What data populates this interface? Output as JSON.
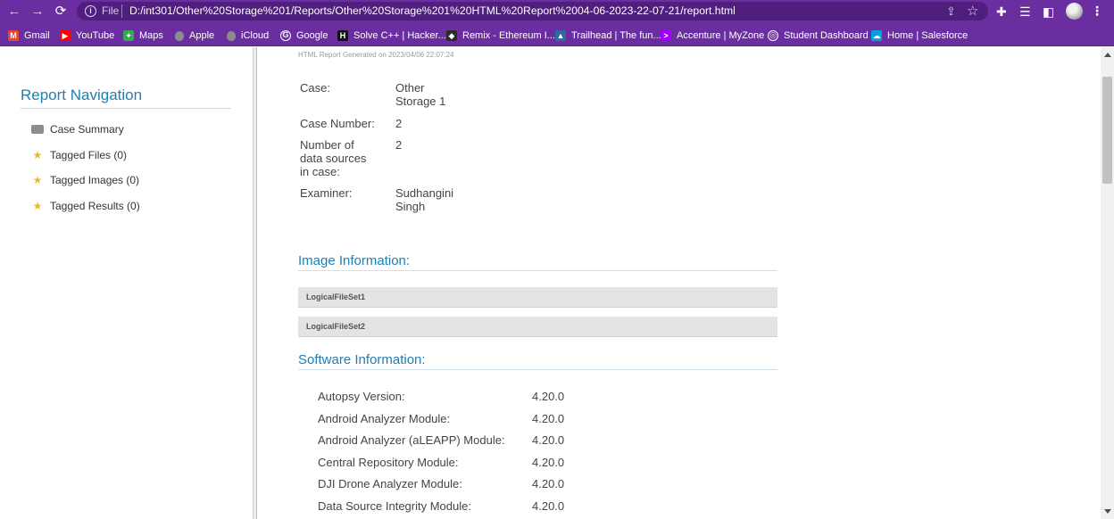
{
  "browser": {
    "omnibox": {
      "scheme_label": "File",
      "url": "D:/int301/Other%20Storage%201/Reports/Other%20Storage%201%20HTML%20Report%2004-06-2023-22-07-21/report.html"
    },
    "bookmarks": [
      {
        "label": "Gmail",
        "icon": "gmail-icon",
        "color": "#ea4335",
        "glyph": "M"
      },
      {
        "label": "YouTube",
        "icon": "youtube-icon",
        "color": "#ff0000",
        "glyph": "▶"
      },
      {
        "label": "Maps",
        "icon": "maps-icon",
        "color": "#34a853",
        "glyph": "✦"
      },
      {
        "label": "Apple",
        "icon": "apple-icon",
        "color": "#8c8c8c",
        "glyph": ""
      },
      {
        "label": "iCloud",
        "icon": "icloud-icon",
        "color": "#8c8c8c",
        "glyph": ""
      },
      {
        "label": "Google",
        "icon": "google-icon",
        "color": "#ffffff",
        "glyph": "G"
      },
      {
        "label": "Solve C++ | Hacker...",
        "icon": "hackerrank-icon",
        "color": "#111111",
        "glyph": "H"
      },
      {
        "label": "Remix - Ethereum I...",
        "icon": "remix-icon",
        "color": "#2b2b2b",
        "glyph": "◆"
      },
      {
        "label": "Trailhead | The fun...",
        "icon": "trailhead-icon",
        "color": "#2d6a9f",
        "glyph": "▲"
      },
      {
        "label": "Accenture | MyZone",
        "icon": "accenture-icon",
        "color": "#a100ff",
        "glyph": ">"
      },
      {
        "label": "Student Dashboard",
        "icon": "student-dashboard-icon",
        "color": "#ffffff",
        "glyph": "◎"
      },
      {
        "label": "Home | Salesforce",
        "icon": "salesforce-icon",
        "color": "#00a1e0",
        "glyph": "☁"
      }
    ]
  },
  "nav": {
    "title": "Report Navigation",
    "items": [
      {
        "label": "Case Summary",
        "icon": "case-icon"
      },
      {
        "label": "Tagged Files (0)",
        "icon": "star-icon"
      },
      {
        "label": "Tagged Images (0)",
        "icon": "star-icon"
      },
      {
        "label": "Tagged Results (0)",
        "icon": "star-icon"
      }
    ]
  },
  "report": {
    "generated_line": "HTML Report Generated on 2023/04/06 22:07:24",
    "case_info": [
      {
        "label_lines": [
          "Case:"
        ],
        "value_lines": [
          "Other",
          "Storage 1"
        ]
      },
      {
        "label_lines": [
          "Case Number:"
        ],
        "value_lines": [
          "2"
        ]
      },
      {
        "label_lines": [
          "Number of",
          "data sources",
          "in case:"
        ],
        "value_lines": [
          "2"
        ]
      },
      {
        "label_lines": [
          "Examiner:"
        ],
        "value_lines": [
          "Sudhangini",
          "Singh"
        ]
      }
    ],
    "image_section_title": "Image Information:",
    "images": [
      "LogicalFileSet1",
      "LogicalFileSet2"
    ],
    "software_section_title": "Software Information:",
    "software": [
      {
        "label": "Autopsy Version:",
        "value": "4.20.0"
      },
      {
        "label": "Android Analyzer Module:",
        "value": "4.20.0"
      },
      {
        "label": "Android Analyzer (aLEAPP) Module:",
        "value": "4.20.0"
      },
      {
        "label": "Central Repository Module:",
        "value": "4.20.0"
      },
      {
        "label": "DJI Drone Analyzer Module:",
        "value": "4.20.0"
      },
      {
        "label": "Data Source Integrity Module:",
        "value": "4.20.0"
      }
    ]
  },
  "colors": {
    "chrome": "#6a2ea0",
    "accent": "#1f7fb3"
  }
}
